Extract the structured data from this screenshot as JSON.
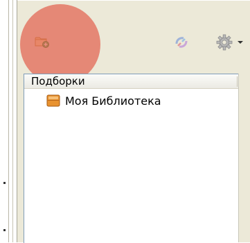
{
  "toolbar": {
    "new_collection_icon": "folder-add-icon",
    "sync_icon": "sync-icon",
    "actions_icon": "gear-icon",
    "actions_dropdown_icon": "chevron-down-icon"
  },
  "collections": {
    "header": "Подборки",
    "items": [
      {
        "label": "Моя Библиотека",
        "icon": "library-icon"
      }
    ]
  },
  "colors": {
    "pane_bg": "#ece9d8",
    "tree_border": "#7f9db9",
    "highlight": "#e26250",
    "library_icon": "#d9822b"
  }
}
